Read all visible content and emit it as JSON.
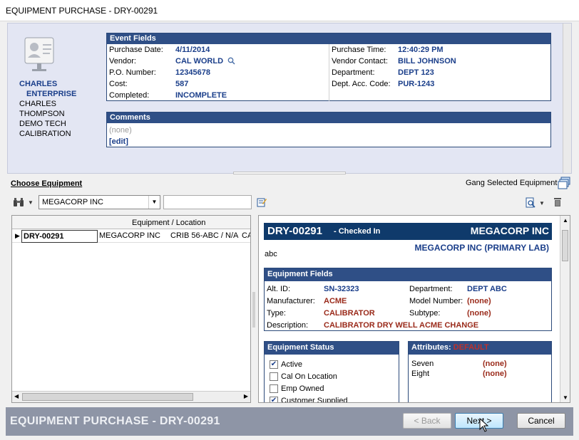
{
  "window": {
    "title": "EQUIPMENT PURCHASE - DRY-00291"
  },
  "person": {
    "enterprise_line1": "CHARLES",
    "enterprise_line2": "ENTERPRISE",
    "name": "CHARLES THOMPSON",
    "company": "DEMO TECH",
    "department": "CALIBRATION"
  },
  "event_fields": {
    "header": "Event Fields",
    "purchase_date_label": "Purchase Date:",
    "purchase_date": "4/11/2014",
    "purchase_time_label": "Purchase Time:",
    "purchase_time": "12:40:29 PM",
    "vendor_label": "Vendor:",
    "vendor": "CAL WORLD",
    "vendor_contact_label": "Vendor Contact:",
    "vendor_contact": "BILL JOHNSON",
    "po_label": "P.O. Number:",
    "po": "12345678",
    "department_label": "Department:",
    "department": "DEPT 123",
    "cost_label": "Cost:",
    "cost": "587",
    "dept_acc_label": "Dept. Acc. Code:",
    "dept_acc": "PUR-1243",
    "completed_label": "Completed:",
    "completed": "INCOMPLETE"
  },
  "comments": {
    "header": "Comments",
    "value": "(none)",
    "edit": "[edit]"
  },
  "choose": {
    "label": "Choose Equipment",
    "gang_label": "Gang Selected Equipment",
    "combo_value": "MEGACORP INC",
    "search_value": ""
  },
  "grid": {
    "column_header": "Equipment / Location",
    "rows": [
      {
        "id": "DRY-00291",
        "org": "MEGACORP INC",
        "loc": "CRIB 56-ABC / N/A",
        "extra": "CA"
      }
    ]
  },
  "detail": {
    "id": "DRY-00291",
    "status": "- Checked In",
    "org": "MEGACORP INC",
    "lab": "MEGACORP INC (PRIMARY LAB)",
    "note": "abc",
    "fields_header": "Equipment Fields",
    "alt_id_label": "Alt. ID:",
    "alt_id": "SN-32323",
    "department_label": "Department:",
    "department": "DEPT ABC",
    "manufacturer_label": "Manufacturer:",
    "manufacturer": "ACME",
    "model_label": "Model Number:",
    "model": "(none)",
    "type_label": "Type:",
    "type": "CALIBRATOR",
    "subtype_label": "Subtype:",
    "subtype": "(none)",
    "description_label": "Description:",
    "description": "CALIBRATOR DRY WELL ACME CHANGE",
    "status_header": "Equipment Status",
    "status_items": [
      {
        "label": "Active",
        "checked": true
      },
      {
        "label": "Cal On Location",
        "checked": false
      },
      {
        "label": "Emp Owned",
        "checked": false
      },
      {
        "label": "Customer Supplied",
        "checked": true
      }
    ],
    "attributes_header": "Attributes:",
    "attributes_default": "DEFAULT",
    "attributes": [
      {
        "name": "Seven",
        "value": "(none)"
      },
      {
        "name": "Eight",
        "value": "(none)"
      }
    ]
  },
  "footer": {
    "title": "EQUIPMENT PURCHASE - DRY-00291",
    "back": "< Back",
    "next": "Next >",
    "cancel": "Cancel"
  },
  "colors": {
    "header_blue": "#2f4f86",
    "value_blue": "#1a3e8a",
    "value_red": "#9a2a1a",
    "footer_bg": "#8e95a6"
  }
}
